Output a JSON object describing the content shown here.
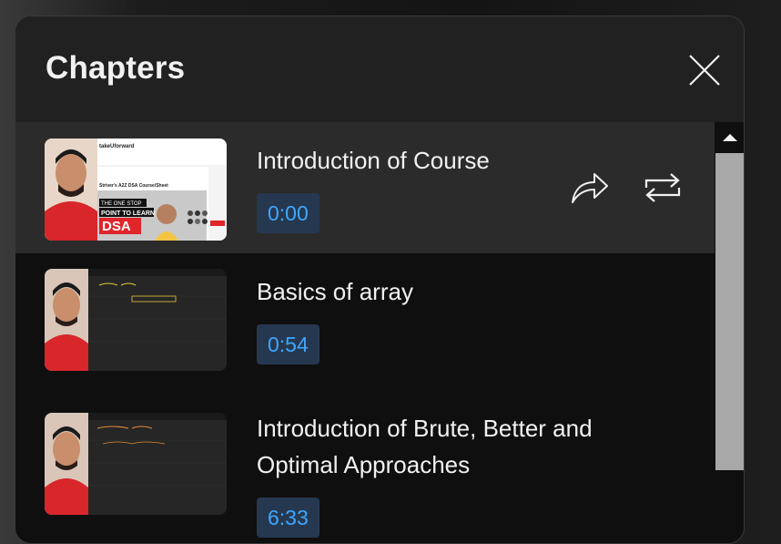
{
  "panel": {
    "title": "Chapters",
    "close_icon": "close-icon"
  },
  "chapters": [
    {
      "title": "Introduction of Course",
      "time": "0:00",
      "active": true,
      "thumbnail": {
        "site": "takeUforward",
        "heading": "Striver's A2Z DSA Course/Sheet",
        "tagline": "THE ONE STOP",
        "tagline2": "POINT TO LEARN",
        "tagline3": "DSA"
      }
    },
    {
      "title": "Basics of array",
      "time": "0:54",
      "active": false
    },
    {
      "title": "Introduction of Brute, Better and Optimal Approaches",
      "time": "6:33",
      "active": false
    }
  ],
  "actions": {
    "share_icon": "share-icon",
    "loop_icon": "loop-icon"
  },
  "scrollbar": {
    "up_icon": "scroll-up-arrow-icon"
  },
  "colors": {
    "accent": "#3ea6ff",
    "badge_bg": "#263850",
    "active_row": "#2b2b2b",
    "header_bg": "#212121"
  }
}
